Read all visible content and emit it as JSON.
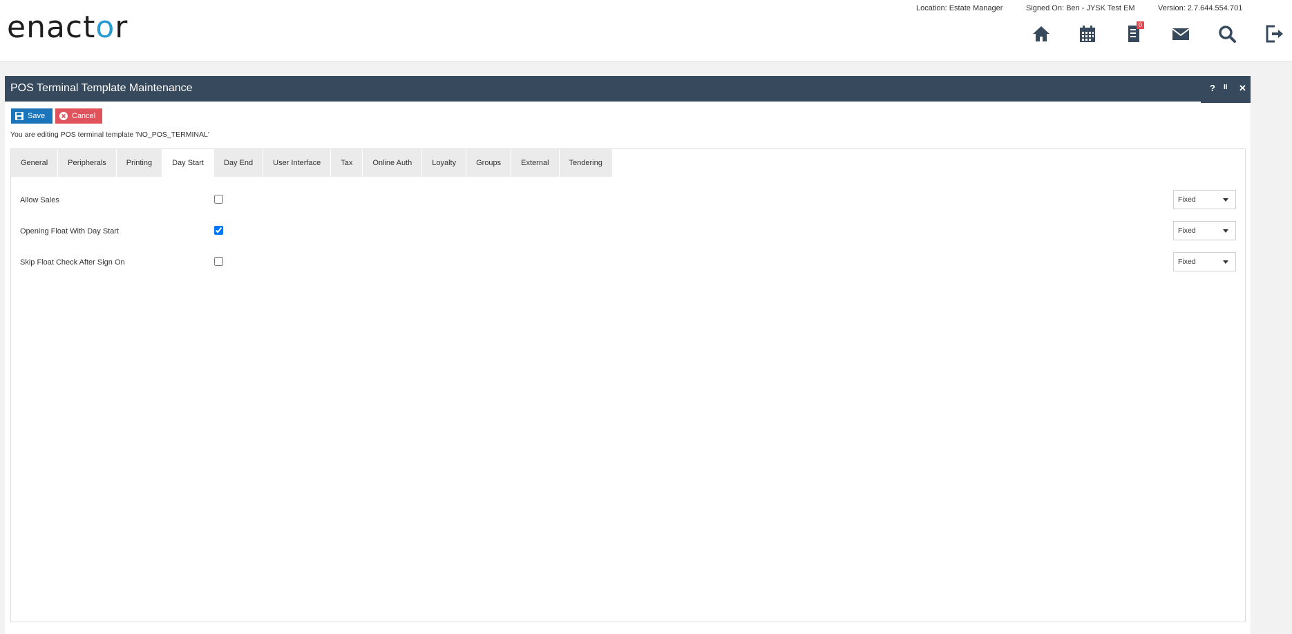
{
  "header": {
    "logo": {
      "prefix": "enact",
      "o": "o",
      "suffix": "r"
    },
    "location": "Location: Estate Manager",
    "signed_on": "Signed On: Ben - JYSK Test EM",
    "version": "Version: 2.7.644.554.701",
    "nav_icons": [
      "home-icon",
      "calendar-icon",
      "tasks-icon",
      "mail-icon",
      "search-icon",
      "logout-icon"
    ],
    "tasks_badge": "0"
  },
  "window": {
    "title": "POS Terminal Template Maintenance",
    "help": "?",
    "pause": "II",
    "close": "✕"
  },
  "toolbar": {
    "save_label": "Save",
    "cancel_label": "Cancel"
  },
  "editing_message": "You are editing POS terminal template 'NO_POS_TERMINAL'",
  "tabs": [
    {
      "label": "General"
    },
    {
      "label": "Peripherals"
    },
    {
      "label": "Printing"
    },
    {
      "label": "Day Start",
      "active": true
    },
    {
      "label": "Day End"
    },
    {
      "label": "User Interface"
    },
    {
      "label": "Tax"
    },
    {
      "label": "Online Auth"
    },
    {
      "label": "Loyalty"
    },
    {
      "label": "Groups"
    },
    {
      "label": "External"
    },
    {
      "label": "Tendering"
    }
  ],
  "settings": [
    {
      "label": "Allow Sales",
      "checked": false,
      "mode": "Fixed"
    },
    {
      "label": "Opening Float With Day Start",
      "checked": true,
      "mode": "Fixed"
    },
    {
      "label": "Skip Float Check After Sign On",
      "checked": false,
      "mode": "Fixed"
    }
  ],
  "colors": {
    "title_bar": "#36495d",
    "save": "#1b75bb",
    "cancel": "#e0525c",
    "logo_accent": "#2a9bd0"
  }
}
